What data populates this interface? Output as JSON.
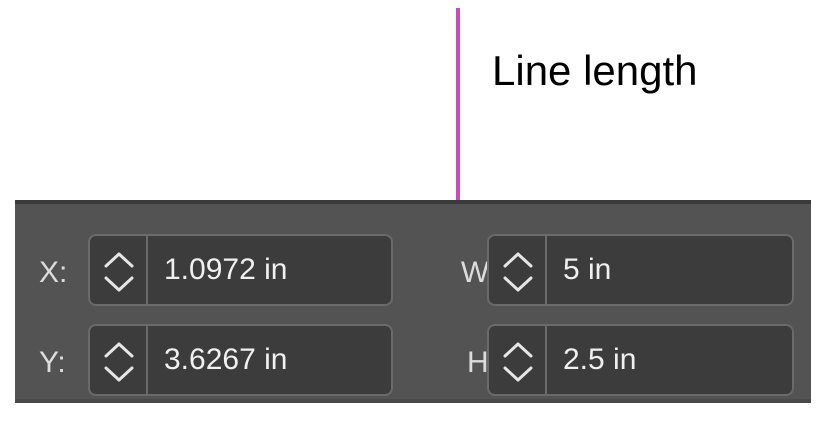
{
  "annotation": {
    "label": "Line length",
    "arrow_color": "#c94bbf"
  },
  "transform_panel": {
    "x": {
      "label": "X:",
      "value": "1.0972 in"
    },
    "y": {
      "label": "Y:",
      "value": "3.6267 in"
    },
    "w": {
      "label": "W:",
      "value": "5 in"
    },
    "h": {
      "label": "H:",
      "value": "2.5 in"
    }
  },
  "icons": {
    "stepper": "chevron-up-down-icon",
    "arrow": "down-arrow-icon"
  },
  "colors": {
    "panel_bg": "#535353",
    "field_bg": "#3c3c3c",
    "field_border": "#6a6a6a",
    "label_text": "#dcdcdc",
    "value_text": "#f0f0f0"
  }
}
